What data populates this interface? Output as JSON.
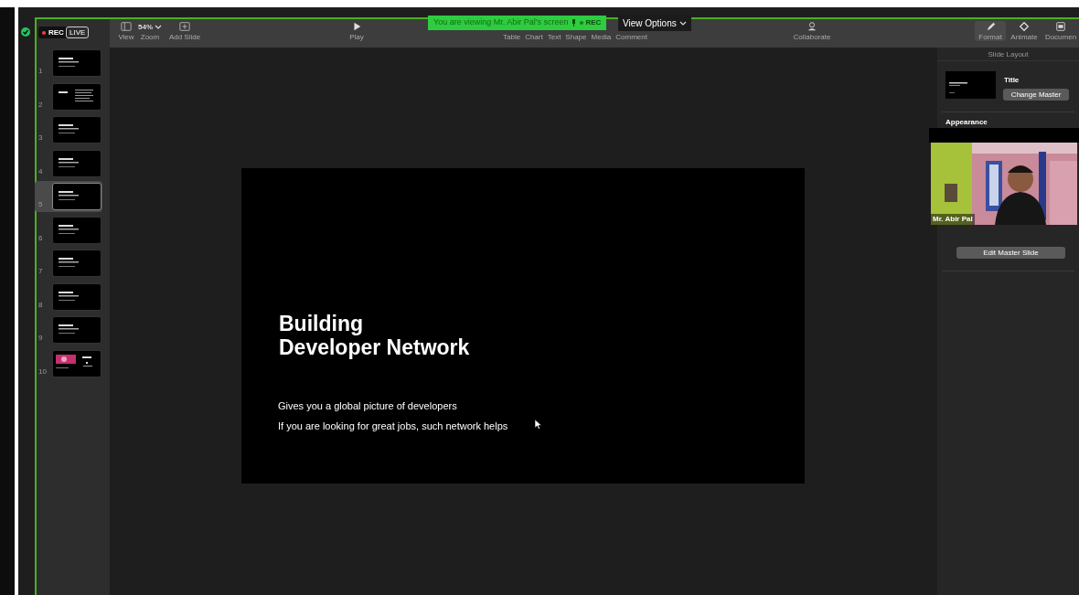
{
  "meeting_bar": {
    "recording": "REC",
    "live": "LIVE"
  },
  "share_banner": {
    "text": "You are viewing Mr. Abir Pal's screen",
    "rec": "REC",
    "view_options": "View Options"
  },
  "toolbar": {
    "left": [
      {
        "label": "View"
      },
      {
        "value": "54%",
        "label": "Zoom"
      },
      {
        "label": "Add Slide"
      }
    ],
    "center": [
      {
        "label": "Play"
      }
    ],
    "insert": [
      {
        "label": "Table"
      },
      {
        "label": "Chart"
      },
      {
        "label": "Text"
      },
      {
        "label": "Shape"
      },
      {
        "label": "Media"
      },
      {
        "label": "Comment"
      }
    ],
    "collaborate": {
      "label": "Collaborate"
    },
    "inspectors": [
      {
        "label": "Format",
        "selected": true
      },
      {
        "label": "Animate",
        "selected": false
      },
      {
        "label": "Documen",
        "selected": false
      }
    ]
  },
  "slides": [
    {
      "number": "1",
      "kind": "text",
      "selected": false
    },
    {
      "number": "2",
      "kind": "columns",
      "selected": false
    },
    {
      "number": "3",
      "kind": "text",
      "selected": false
    },
    {
      "number": "4",
      "kind": "text",
      "selected": false
    },
    {
      "number": "5",
      "kind": "text",
      "selected": true
    },
    {
      "number": "6",
      "kind": "text",
      "selected": false
    },
    {
      "number": "7",
      "kind": "text",
      "selected": false
    },
    {
      "number": "8",
      "kind": "text",
      "selected": false
    },
    {
      "number": "9",
      "kind": "text",
      "selected": false
    },
    {
      "number": "10",
      "kind": "picture",
      "selected": false
    }
  ],
  "slide": {
    "title_lines": [
      "Building",
      "Developer Network"
    ],
    "body_lines": [
      "Gives you a global picture of developers",
      "If you are looking for great jobs, such network helps"
    ]
  },
  "inspector": {
    "heading": "Slide Layout",
    "master_name": "Title",
    "change_master": "Change Master",
    "appearance": "Appearance",
    "edit_master": "Edit Master Slide"
  },
  "video": {
    "kind": "picture",
    "name": "Mr. Abir Pal"
  }
}
